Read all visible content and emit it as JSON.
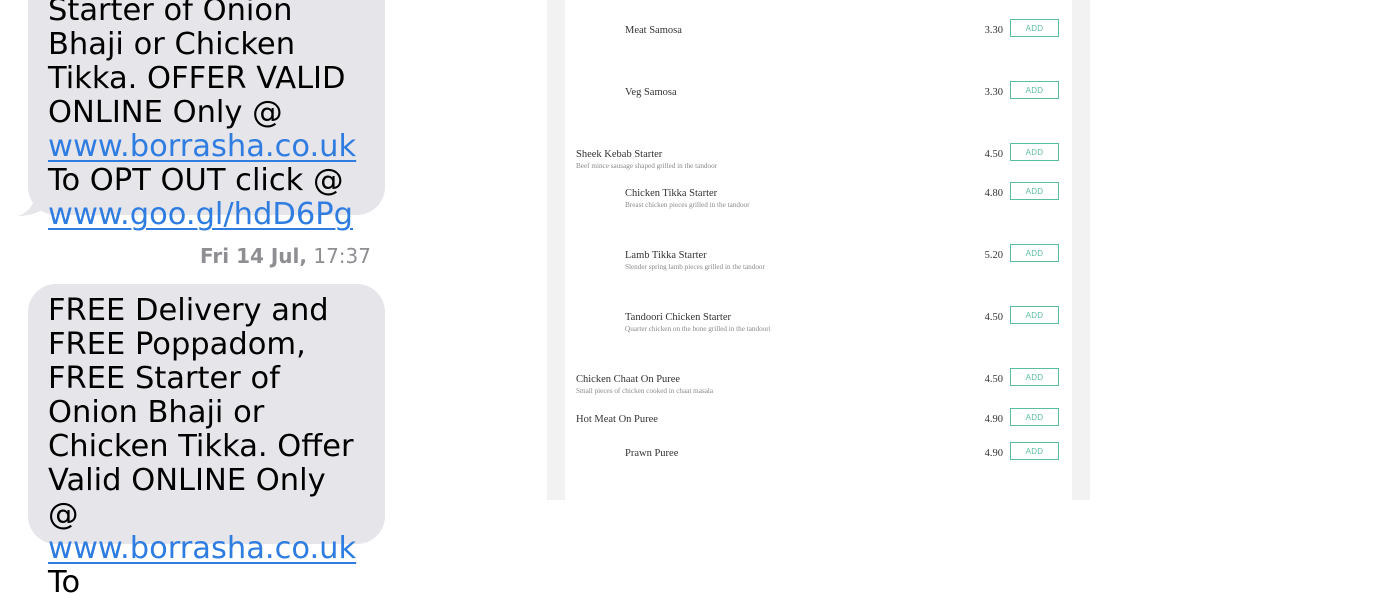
{
  "messages": [
    {
      "text_before_link1": "Starter of Onion Bhaji or Chicken Tikka. OFFER VALID ONLINE Only @ ",
      "link1": "www.borrasha.co.uk",
      "text_between": " To OPT OUT click @ ",
      "link2": "www.goo.gl/hdD6Pg"
    },
    {
      "text_before_link1": "FREE Delivery and FREE Poppadom, FREE Starter of Onion Bhaji or Chicken Tikka. Offer Valid ONLINE Only @ ",
      "link1": "www.borrasha.co.uk",
      "text_after_link1": " To"
    }
  ],
  "timestamp": {
    "day": "Fri 14 Jul,",
    "time": "17:37"
  },
  "menu": {
    "add_label": "ADD",
    "items": [
      {
        "name": "Meat Samosa",
        "desc": "",
        "price": "3.30"
      },
      {
        "name": "Veg Samosa",
        "desc": "",
        "price": "3.30"
      },
      {
        "name": "Sheek Kebab Starter",
        "desc": "Beef mince sausage shaped grilled in the tandoor",
        "price": "4.50"
      },
      {
        "name": "Chicken Tikka Starter",
        "desc": "Breast chicken pieces grilled in the tandoor",
        "price": "4.80"
      },
      {
        "name": "Lamb Tikka Starter",
        "desc": "Slender spring lamb pieces grilled in the tandoor",
        "price": "5.20"
      },
      {
        "name": "Tandoori Chicken Starter",
        "desc": "Quarter chicken on the bone grilled in the tandoori",
        "price": "4.50"
      },
      {
        "name": "Chicken Chaat On Puree",
        "desc": "Small pieces of chicken cooked in chaat masala",
        "price": "4.50"
      },
      {
        "name": "Hot Meat On Puree",
        "desc": "",
        "price": "4.90"
      },
      {
        "name": "Prawn Puree",
        "desc": "",
        "price": "4.90"
      }
    ]
  },
  "colors": {
    "bubble": "#e6e5ea",
    "link": "#2f7de1",
    "add_button": "#5bbd9f"
  }
}
